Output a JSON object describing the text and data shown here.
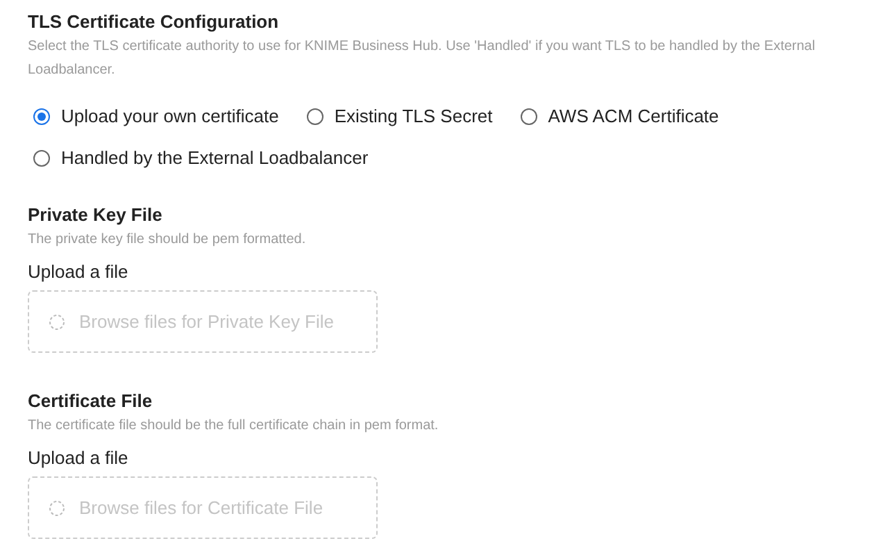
{
  "section": {
    "title": "TLS Certificate Configuration",
    "description": "Select the TLS certificate authority to use for KNIME Business Hub. Use 'Handled' if you want TLS to be handled by the External Loadbalancer."
  },
  "options": [
    {
      "label": "Upload your own certificate",
      "selected": true
    },
    {
      "label": "Existing TLS Secret",
      "selected": false
    },
    {
      "label": "AWS ACM Certificate",
      "selected": false
    },
    {
      "label": "Handled by the External Loadbalancer",
      "selected": false
    }
  ],
  "files": [
    {
      "title": "Private Key File",
      "description": "The private key file should be pem formatted.",
      "upload_label": "Upload a file",
      "button": "Browse files for Private Key File",
      "disabled": true
    },
    {
      "title": "Certificate File",
      "description": "The certificate file should be the full certificate chain in pem format.",
      "upload_label": "Upload a file",
      "button": "Browse files for Certificate File",
      "disabled": true
    }
  ]
}
